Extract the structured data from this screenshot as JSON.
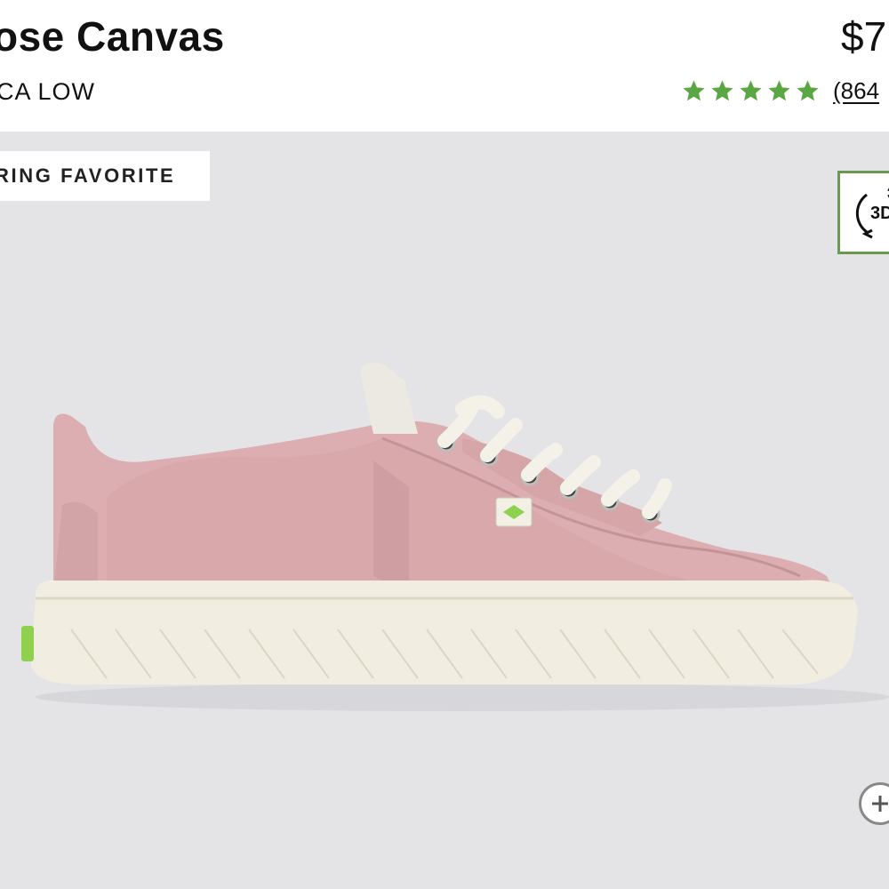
{
  "product": {
    "title": "ose Canvas",
    "subtitle": "CA LOW",
    "price": "$7"
  },
  "rating": {
    "stars": 5,
    "reviews_label": "(864",
    "star_color": "#5aa744"
  },
  "gallery": {
    "badge": "RING FAVORITE",
    "view_3d_label": "3D",
    "view_3d_border_color": "#6a9a4e",
    "background_color": "#e4e4e7",
    "zoom_icon": "zoom-in-icon"
  },
  "shoe_colors": {
    "canvas": "#ddb1b4",
    "sole": "#f1ede0",
    "laces": "#f6f3ea",
    "tag": "#8fd14f"
  }
}
